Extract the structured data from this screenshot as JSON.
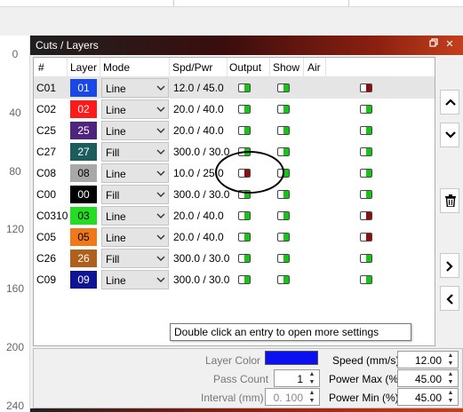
{
  "ruler": {
    "ticks": [
      "0",
      "40",
      "80",
      "120",
      "160",
      "200",
      "240"
    ]
  },
  "panel": {
    "title": "Cuts / Layers",
    "float_icon": "restore-icon",
    "close_icon": "close-icon"
  },
  "table": {
    "headers": [
      "#",
      "Layer",
      "Mode",
      "Spd/Pwr",
      "Output",
      "Show",
      "Air"
    ],
    "rows": [
      {
        "id": "C01",
        "layer": "01",
        "layer_color": "#1947e8",
        "layer_text_color": "#ffffff",
        "mode": "Line",
        "spd_pwr": "12.0 / 45.0",
        "output": "on",
        "show": "on",
        "air": "off",
        "selected": true
      },
      {
        "id": "C02",
        "layer": "02",
        "layer_color": "#ff1a1a",
        "layer_text_color": "#ffffff",
        "mode": "Line",
        "spd_pwr": "20.0 / 40.0",
        "output": "on",
        "show": "on",
        "air": "on",
        "selected": false
      },
      {
        "id": "C25",
        "layer": "25",
        "layer_color": "#4f247f",
        "layer_text_color": "#ffffff",
        "mode": "Line",
        "spd_pwr": "20.0 / 40.0",
        "output": "on",
        "show": "on",
        "air": "on",
        "selected": false
      },
      {
        "id": "C27",
        "layer": "27",
        "layer_color": "#1d5c5c",
        "layer_text_color": "#ffffff",
        "mode": "Fill",
        "spd_pwr": "300.0 / 30.0",
        "output": "on",
        "show": "on",
        "air": "on",
        "selected": false
      },
      {
        "id": "C08",
        "layer": "08",
        "layer_color": "#a8a8a8",
        "layer_text_color": "#000000",
        "mode": "Line",
        "spd_pwr": "10.0 / 25.0",
        "output": "off",
        "show": "on",
        "air": "on",
        "selected": false
      },
      {
        "id": "C00",
        "layer": "00",
        "layer_color": "#000000",
        "layer_text_color": "#ffffff",
        "mode": "Fill",
        "spd_pwr": "300.0 / 30.0",
        "output": "on",
        "show": "on",
        "air": "on",
        "selected": false
      },
      {
        "id": "C0310",
        "layer": "03",
        "layer_color": "#22dd22",
        "layer_text_color": "#000000",
        "mode": "Line",
        "spd_pwr": "20.0 / 40.0",
        "output": "on",
        "show": "on",
        "air": "off",
        "selected": false
      },
      {
        "id": "C05",
        "layer": "05",
        "layer_color": "#f07818",
        "layer_text_color": "#000000",
        "mode": "Line",
        "spd_pwr": "20.0 / 40.0",
        "output": "on",
        "show": "on",
        "air": "off",
        "selected": false
      },
      {
        "id": "C26",
        "layer": "26",
        "layer_color": "#b0601a",
        "layer_text_color": "#ffffff",
        "mode": "Fill",
        "spd_pwr": "300.0 / 30.0",
        "output": "on",
        "show": "on",
        "air": "on",
        "selected": false
      },
      {
        "id": "C09",
        "layer": "09",
        "layer_color": "#0f1496",
        "layer_text_color": "#ffffff",
        "mode": "Line",
        "spd_pwr": "300.0 / 30.0",
        "output": "on",
        "show": "on",
        "air": "on",
        "selected": false
      }
    ]
  },
  "side_buttons": {
    "up_icon": "chevron-up-icon",
    "down_icon": "chevron-down-icon",
    "delete_icon": "trash-icon",
    "right_icon": "chevron-right-icon",
    "left_icon": "chevron-left-icon"
  },
  "settings": {
    "layer_color_label": "Layer Color",
    "layer_color_value": "#0a10f0",
    "speed_label": "Speed (mm/s)",
    "speed_value": "12.00",
    "pass_count_label": "Pass Count",
    "pass_count_value": "1",
    "power_max_label": "Power Max (%)",
    "power_max_value": "45.00",
    "interval_label": "Interval (mm)",
    "interval_value": "0. 100",
    "power_min_label": "Power Min (%)",
    "power_min_value": "45.00"
  },
  "tooltip": {
    "text": "Double click an entry to open more settings"
  },
  "colors": {
    "toggle_on": "#16c416",
    "toggle_off": "#8b0d0d",
    "accent_title": "#c4401c"
  }
}
